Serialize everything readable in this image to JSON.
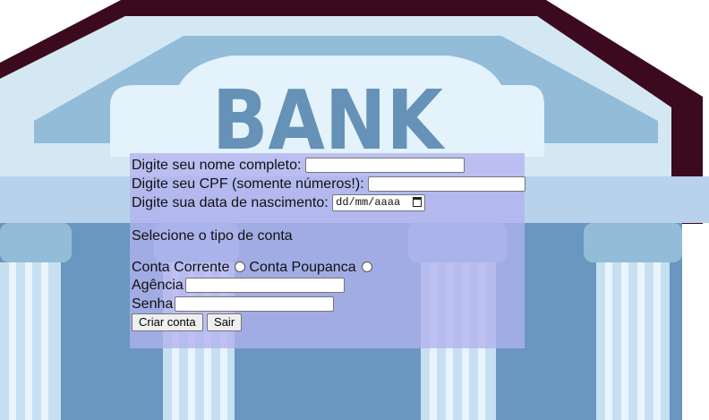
{
  "logo": {
    "text": "BANK"
  },
  "form": {
    "name_label": "Digite seu nome completo:",
    "name_value": "",
    "cpf_label": "Digite seu CPF (somente números!):",
    "cpf_value": "",
    "birth_label": "Digite sua data de nascimento:",
    "birth_placeholder": "dd/mm/aaaa",
    "account_type_heading": "Selecione o tipo de conta",
    "option_corrente": "Conta Corrente",
    "option_poupanca": "Conta Poupanca",
    "agency_label": "Agência",
    "agency_value": "",
    "password_label": "Senha",
    "password_value": "",
    "create_button": "Criar conta",
    "exit_button": "Sair"
  },
  "colors": {
    "roof_outline": "#3b0a1e",
    "roof_light": "#d4e8f4",
    "roof_mid": "#93bcd8",
    "column_blue": "#6a97c0",
    "column_light": "#c6e0f1",
    "logo_text": "#6592b6",
    "panel": "#b2b2ee"
  }
}
